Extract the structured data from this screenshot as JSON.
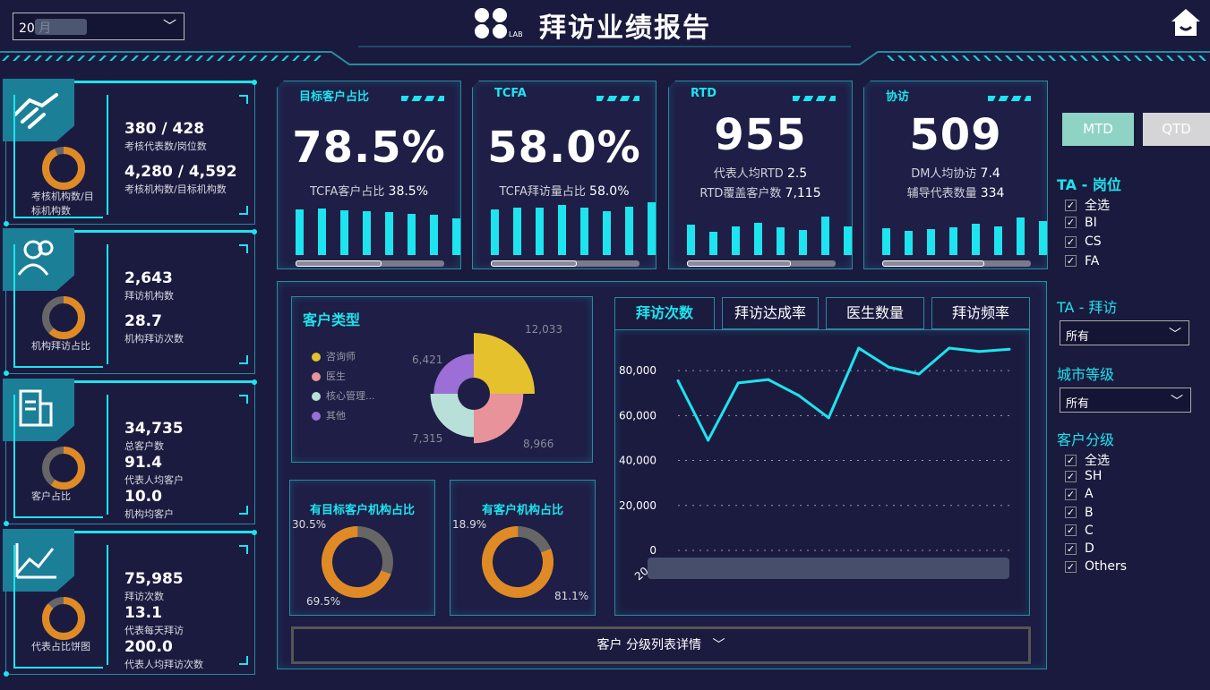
{
  "header": {
    "title": "拜访业绩报告",
    "logo_text": "LAB",
    "date_select": {
      "value": "20 月"
    }
  },
  "left_cards": [
    {
      "donut_label": "考核机构数/目标机构数",
      "donut_pct": 0.93,
      "rows": [
        {
          "value": "380 / 428",
          "label": "考核代表数/岗位数"
        },
        {
          "value": "4,280 / 4,592",
          "label": "考核机构数/目标机构数"
        }
      ]
    },
    {
      "donut_label": "机构拜访占比",
      "donut_pct": 0.62,
      "rows": [
        {
          "value": "2,643",
          "label": "拜访机构数"
        },
        {
          "value": "28.7",
          "label": "机构拜访次数"
        }
      ]
    },
    {
      "donut_label": "客户占比",
      "donut_pct": 0.6,
      "rows": [
        {
          "value": "34,735",
          "label": "总客户数"
        },
        {
          "value": "91.4",
          "label": "代表人均客户"
        },
        {
          "value": "10.0",
          "label": "机构均客户"
        }
      ]
    },
    {
      "donut_label": "代表占比饼图",
      "donut_pct": 0.87,
      "rows": [
        {
          "value": "75,985",
          "label": "拜访次数"
        },
        {
          "value": "13.1",
          "label": "代表每天拜访"
        },
        {
          "value": "200.0",
          "label": "代表人均拜访次数"
        }
      ]
    }
  ],
  "kpis": [
    {
      "title": "目标客户占比",
      "value": "78.5%",
      "sub": [
        {
          "label": "TCFA客户占比",
          "value": "38.5%"
        }
      ],
      "bars": [
        0.82,
        0.84,
        0.8,
        0.79,
        0.77,
        0.74,
        0.72,
        0.66
      ]
    },
    {
      "title": "TCFA",
      "value": "58.0%",
      "sub": [
        {
          "label": "TCFA拜访量占比",
          "value": "58.0%"
        }
      ],
      "bars": [
        0.82,
        0.86,
        0.86,
        0.9,
        0.86,
        0.79,
        0.87,
        0.95
      ]
    },
    {
      "title": "RTD",
      "value": "955",
      "sub": [
        {
          "label": "代表人均RTD",
          "value": "2.5"
        },
        {
          "label": "RTD覆盖客户数",
          "value": "7,115"
        }
      ],
      "bars": [
        0.55,
        0.42,
        0.52,
        0.58,
        0.5,
        0.45,
        0.7,
        0.52
      ]
    },
    {
      "title": "协访",
      "value": "509",
      "sub": [
        {
          "label": "DM人均协访",
          "value": "7.4"
        },
        {
          "label": "辅导代表数量",
          "value": "334"
        }
      ],
      "bars": [
        0.48,
        0.44,
        0.46,
        0.5,
        0.56,
        0.52,
        0.68,
        0.62
      ]
    }
  ],
  "period_buttons": {
    "mtd": "MTD",
    "qtd": "QTD"
  },
  "customer_type": {
    "title": "客户类型",
    "legend": [
      {
        "name": "咨询师",
        "color": "#e6c12e",
        "value": 12033,
        "label": "12,033"
      },
      {
        "name": "医生",
        "color": "#e8939a",
        "value": 8966,
        "label": "8,966"
      },
      {
        "name": "核心管理...",
        "color": "#b8e0d8",
        "value": 7315,
        "label": "7,315"
      },
      {
        "name": "其他",
        "color": "#9b6fd6",
        "value": 6421,
        "label": "6,421"
      }
    ]
  },
  "donut_cards": [
    {
      "title": "有目标客户机构占比",
      "pct_small": "30.5%",
      "pct_large": "69.5%",
      "large": 0.695
    },
    {
      "title": "有客户机构占比",
      "pct_small": "18.9%",
      "pct_large": "81.1%",
      "large": 0.811
    }
  ],
  "tabs": [
    "拜访次数",
    "拜访达成率",
    "医生数量",
    "拜访频率"
  ],
  "line_chart": {
    "type": "line",
    "ylim": [
      0,
      90000
    ],
    "yticks": [
      {
        "v": 0,
        "label": "0"
      },
      {
        "v": 20000,
        "label": "20,000"
      },
      {
        "v": 40000,
        "label": "40,000"
      },
      {
        "v": 60000,
        "label": "60,000"
      },
      {
        "v": 80000,
        "label": "80,000"
      }
    ],
    "x_label_start": "20",
    "series": [
      {
        "values": [
          75500,
          49000,
          74500,
          76000,
          69000,
          59000,
          90000,
          81500,
          78500,
          90000,
          88500,
          89500
        ]
      }
    ]
  },
  "filters": {
    "ta_role_title": "TA - 岗位",
    "ta_role_items": [
      "全选",
      "BI",
      "CS",
      "FA"
    ],
    "ta_visit_title": "TA - 拜访",
    "ta_visit_value": "所有",
    "city_title": "城市等级",
    "city_value": "所有",
    "tier_title": "客户分级",
    "tier_items": [
      "全选",
      "SH",
      "A",
      "B",
      "C",
      "D",
      "Others"
    ]
  },
  "footer_button": "客户 分级列表详情"
}
